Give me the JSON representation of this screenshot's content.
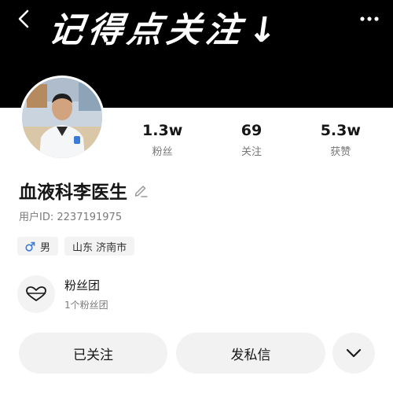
{
  "header": {
    "banner_text": "记得点关注",
    "banner_arrow": "↓"
  },
  "profile": {
    "name": "血液科李医生",
    "user_id_label": "用户ID:",
    "user_id": "2237191975"
  },
  "stats": [
    {
      "value": "1.3w",
      "label": "粉丝"
    },
    {
      "value": "69",
      "label": "关注"
    },
    {
      "value": "5.3w",
      "label": "获赞"
    }
  ],
  "tags": {
    "gender": "男",
    "location": "山东 济南市"
  },
  "fan_group": {
    "title": "粉丝团",
    "subtitle": "1个粉丝团"
  },
  "actions": {
    "followed_label": "已关注",
    "message_label": "发私信"
  },
  "colors": {
    "banner_bg": "#000000",
    "button_bg": "#f2f2f2",
    "gender_icon": "#3a7bd5"
  },
  "icons": [
    "back-arrow-icon",
    "more-dots-icon",
    "edit-pencil-icon",
    "male-icon",
    "heart-mask-icon",
    "chevron-down-icon"
  ]
}
